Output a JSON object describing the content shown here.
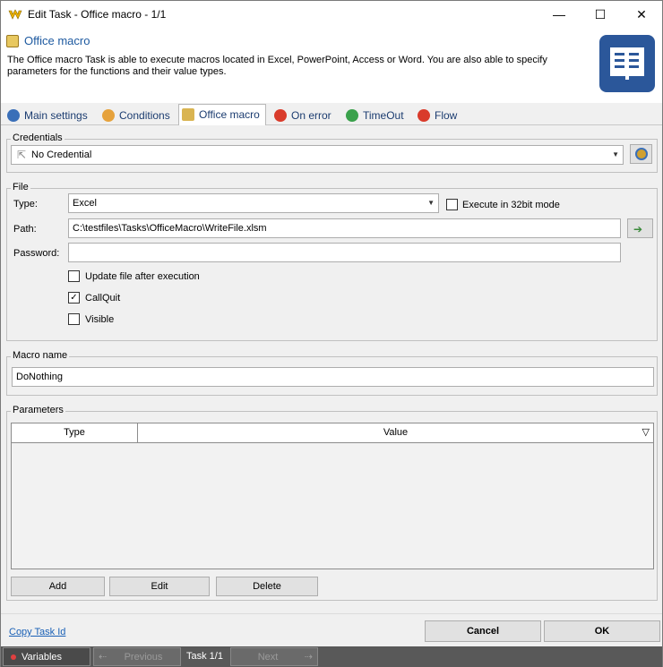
{
  "window": {
    "title": "Edit Task - Office macro - 1/1",
    "minimize": "—",
    "maximize": "☐",
    "close": "✕"
  },
  "header": {
    "title": "Office macro",
    "description": "The Office macro Task is able to execute macros located in Excel, PowerPoint, Access or Word. You are also able to specify parameters for the functions and their value types."
  },
  "tabs": [
    {
      "label": "Main settings",
      "icon": "gear-icon",
      "color": "#3a6fb8"
    },
    {
      "label": "Conditions",
      "icon": "clock-icon",
      "color": "#e6a23c"
    },
    {
      "label": "Office macro",
      "icon": "document-icon",
      "color": "#d9b451"
    },
    {
      "label": "On error",
      "icon": "error-icon",
      "color": "#d93b2b"
    },
    {
      "label": "TimeOut",
      "icon": "timeout-icon",
      "color": "#3aa14b"
    },
    {
      "label": "Flow",
      "icon": "flow-icon",
      "color": "#d93b2b"
    }
  ],
  "active_tab": "Office macro",
  "credentials": {
    "legend": "Credentials",
    "value": "No Credential"
  },
  "file": {
    "legend": "File",
    "type_label": "Type:",
    "type_value": "Excel",
    "execute32_label": "Execute in 32bit mode",
    "execute32_checked": false,
    "path_label": "Path:",
    "path_value": "C:\\testfiles\\Tasks\\OfficeMacro\\WriteFile.xlsm",
    "password_label": "Password:",
    "password_value": "",
    "update_label": "Update file after execution",
    "update_checked": false,
    "callquit_label": "CallQuit",
    "callquit_checked": true,
    "visible_label": "Visible",
    "visible_checked": false
  },
  "macro": {
    "legend": "Macro name",
    "value": "DoNothing"
  },
  "parameters": {
    "legend": "Parameters",
    "columns": [
      "Type",
      "Value"
    ],
    "rows": [],
    "add_label": "Add",
    "edit_label": "Edit",
    "delete_label": "Delete"
  },
  "footer": {
    "copy_link": "Copy Task Id",
    "cancel_label": "Cancel",
    "ok_label": "OK"
  },
  "statusbar": {
    "variables_label": "Variables",
    "previous_label": "Previous",
    "task_counter": "Task 1/1",
    "next_label": "Next"
  },
  "colors": {
    "accent": "#1e5aa0",
    "word_blue": "#2b579a",
    "statusbar": "#595959"
  }
}
